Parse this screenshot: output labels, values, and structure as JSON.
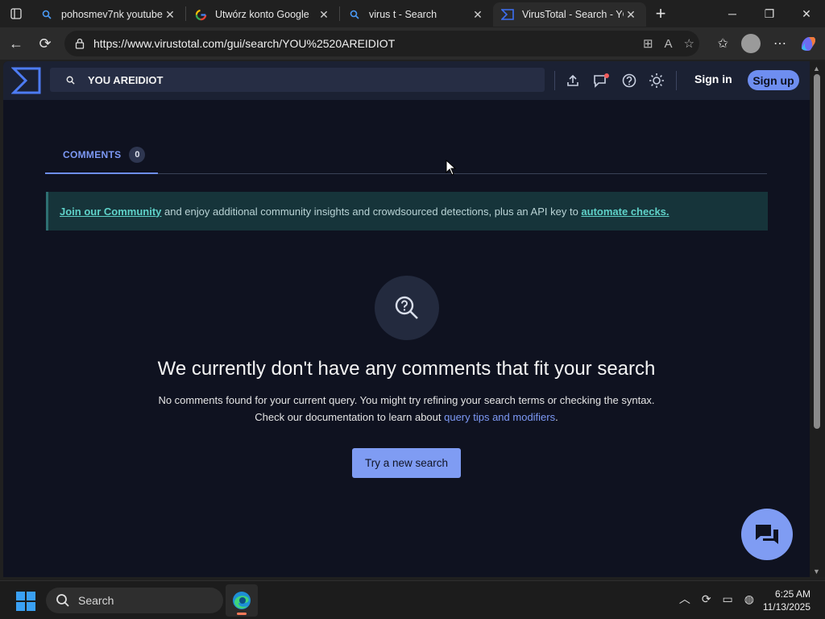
{
  "browser": {
    "tabs": [
      {
        "title": "pohosmev7nk youtube -",
        "icon": "search-icon"
      },
      {
        "title": "Utwórz konto Google",
        "icon": "google-icon"
      },
      {
        "title": "virus t - Search",
        "icon": "search-icon"
      },
      {
        "title": "VirusTotal - Search - YOU",
        "icon": "virustotal-icon"
      }
    ],
    "url": "https://www.virustotal.com/gui/search/YOU%2520AREIDIOT"
  },
  "vt": {
    "search_value": "YOU AREIDIOT",
    "sign_in": "Sign in",
    "sign_up": "Sign up",
    "brand_color": "#6e8ef0"
  },
  "comments": {
    "tab_label": "COMMENTS",
    "count": "0"
  },
  "banner": {
    "link1": "Join our Community",
    "middle": " and enjoy additional community insights and crowdsourced detections, plus an API key to ",
    "link2": "automate checks."
  },
  "empty": {
    "title": "We currently don't have any comments that fit your search",
    "desc1": "No comments found for your current query. You might try refining your search terms or checking the syntax.",
    "desc2_prefix": "Check our documentation to learn about ",
    "desc2_link": "query tips and modifiers",
    "desc2_suffix": ".",
    "button": "Try a new search"
  },
  "taskbar": {
    "search_label": "Search",
    "time": "6:25 AM",
    "date": "11/13/2025"
  }
}
